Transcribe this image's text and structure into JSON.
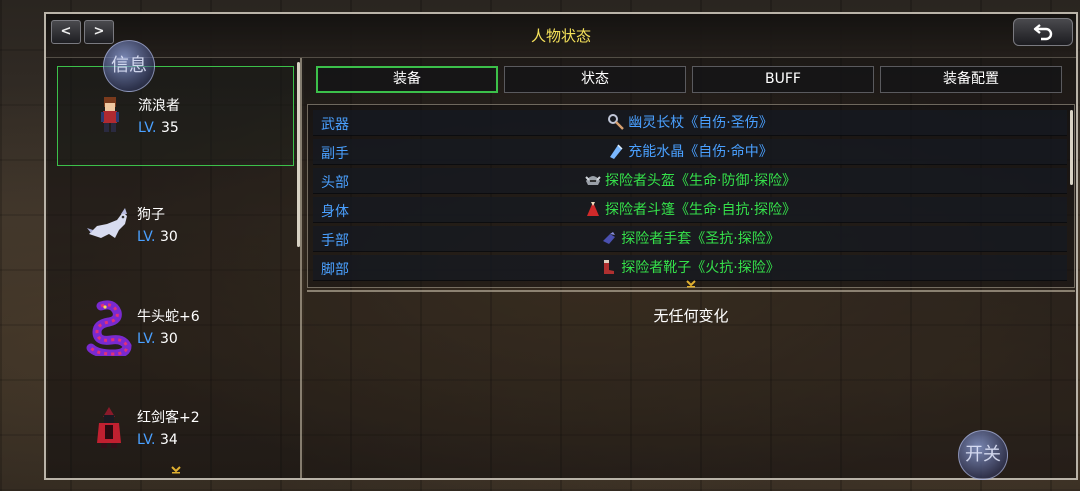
{
  "title": "人物状态",
  "nav": {
    "prev": "<",
    "next": ">"
  },
  "info_button": "信息",
  "switch_button": "开关",
  "characters": [
    {
      "name": "流浪者",
      "lv_label": "LV.",
      "level": "35"
    },
    {
      "name": "狗子",
      "lv_label": "LV.",
      "level": "30"
    },
    {
      "name": "牛头蛇+6",
      "lv_label": "LV.",
      "level": "30"
    },
    {
      "name": "红剑客+2",
      "lv_label": "LV.",
      "level": "34"
    }
  ],
  "tabs": [
    "装备",
    "状态",
    "BUFF",
    "装备配置"
  ],
  "equipment": [
    {
      "slot": "武器",
      "item": "幽灵长杖《自伤·圣伤》",
      "color": "#4aa0ff",
      "icon": "staff-icon"
    },
    {
      "slot": "副手",
      "item": "充能水晶《自伤·命中》",
      "color": "#4aa0ff",
      "icon": "crystal-icon"
    },
    {
      "slot": "头部",
      "item": "探险者头盔《生命·防御·探险》",
      "color": "#35e04a",
      "icon": "helmet-icon"
    },
    {
      "slot": "身体",
      "item": "探险者斗篷《生命·自抗·探险》",
      "color": "#35e04a",
      "icon": "cloak-icon"
    },
    {
      "slot": "手部",
      "item": "探险者手套《圣抗·探险》",
      "color": "#35e04a",
      "icon": "glove-icon"
    },
    {
      "slot": "脚部",
      "item": "探险者靴子《火抗·探险》",
      "color": "#35e04a",
      "icon": "boots-icon"
    }
  ],
  "status_message": "无任何变化"
}
